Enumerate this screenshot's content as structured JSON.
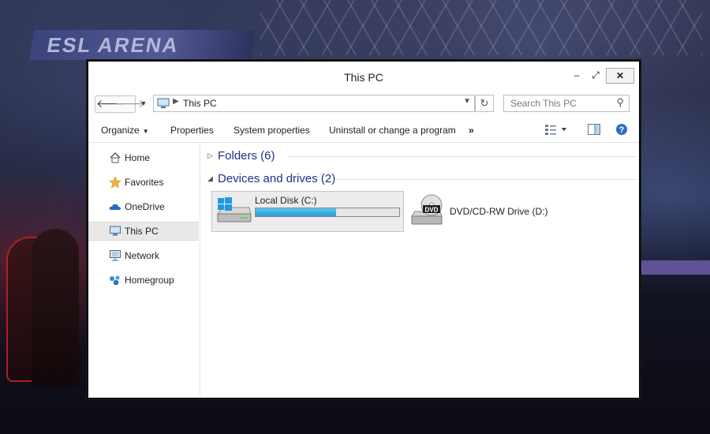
{
  "window": {
    "title": "This PC",
    "minimize_glyph": "–",
    "maximize_glyph": "⤢",
    "close_glyph": "✕"
  },
  "navigation": {
    "back_icon": "arrow-left-icon",
    "forward_icon": "arrow-right-icon",
    "address_path": "This PC",
    "search_placeholder": "Search This PC"
  },
  "toolbar": {
    "items": [
      "Organize",
      "Properties",
      "System properties",
      "Uninstall or change a program"
    ],
    "overflow_glyph": "»"
  },
  "sidebar": {
    "items": [
      {
        "label": "Home",
        "icon": "home-icon"
      },
      {
        "label": "Favorites",
        "icon": "star-icon"
      },
      {
        "label": "OneDrive",
        "icon": "cloud-icon"
      },
      {
        "label": "This PC",
        "icon": "computer-icon",
        "selected": true
      },
      {
        "label": "Network",
        "icon": "network-icon"
      },
      {
        "label": "Homegroup",
        "icon": "homegroup-icon"
      }
    ]
  },
  "content": {
    "groups": [
      {
        "label": "Folders (6)",
        "expanded": false
      },
      {
        "label": "Devices and drives (2)",
        "expanded": true
      }
    ],
    "drives": [
      {
        "name": "Local Disk (C:)",
        "icon": "hard-drive-icon",
        "usage_fraction": 0.56,
        "selected": true
      },
      {
        "name": "DVD/CD-RW Drive (D:)",
        "icon": "dvd-drive-icon",
        "icon_text": "DVD"
      }
    ]
  },
  "background": {
    "banner_text": "ESL ARENA",
    "accent": "#269fd8"
  }
}
